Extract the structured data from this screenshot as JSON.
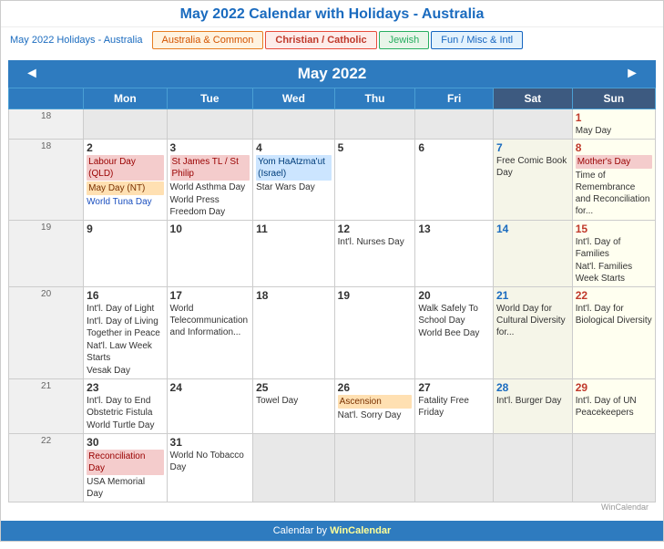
{
  "header": {
    "title": "May 2022 Calendar with Holidays - Australia"
  },
  "filter": {
    "label": "May 2022 Holidays - Australia",
    "tabs": [
      {
        "label": "Australia & Common",
        "class": "australia"
      },
      {
        "label": "Christian / Catholic",
        "class": "christian"
      },
      {
        "label": "Jewish",
        "class": "jewish"
      },
      {
        "label": "Fun / Misc & Intl",
        "class": "fun"
      }
    ]
  },
  "calendar": {
    "nav_prev": "◄",
    "nav_next": "►",
    "month_year": "May 2022",
    "days_of_week": [
      "Mon",
      "Tue",
      "Wed",
      "Thu",
      "Fri",
      "Sat",
      "Sun"
    ],
    "weeks": [
      {
        "week_num": "18",
        "days": [
          {
            "date": "",
            "events": [],
            "empty": true
          },
          {
            "date": "",
            "events": [],
            "empty": true
          },
          {
            "date": "",
            "events": [],
            "empty": true
          },
          {
            "date": "",
            "events": [],
            "empty": true
          },
          {
            "date": "",
            "events": [],
            "empty": true
          },
          {
            "date": "",
            "events": [],
            "empty": true
          },
          {
            "date": "1",
            "events": [
              {
                "text": "May Day",
                "class": ""
              }
            ],
            "empty": false,
            "type": "sun"
          }
        ]
      },
      {
        "week_num": "18",
        "days": [
          {
            "date": "2",
            "events": [
              {
                "text": "Labour Day (QLD)",
                "class": "red-bg"
              },
              {
                "text": "May Day (NT)",
                "class": "orange-bg"
              },
              {
                "text": "World Tuna Day",
                "class": "blue-text"
              }
            ],
            "empty": false,
            "type": "mon"
          },
          {
            "date": "3",
            "events": [
              {
                "text": "St James TL / St Philip",
                "class": "red-bg"
              },
              {
                "text": "World Asthma Day",
                "class": ""
              },
              {
                "text": "World Press Freedom Day",
                "class": ""
              }
            ],
            "empty": false,
            "type": "tue"
          },
          {
            "date": "4",
            "events": [
              {
                "text": "Yom HaAtzma'ut (Israel)",
                "class": "blue-bg"
              },
              {
                "text": "Star Wars Day",
                "class": ""
              }
            ],
            "empty": false,
            "type": "wed"
          },
          {
            "date": "5",
            "events": [],
            "empty": false,
            "type": "thu"
          },
          {
            "date": "6",
            "events": [],
            "empty": false,
            "type": "fri"
          },
          {
            "date": "7",
            "events": [
              {
                "text": "Free Comic Book Day",
                "class": ""
              }
            ],
            "empty": false,
            "type": "sat"
          },
          {
            "date": "8",
            "events": [
              {
                "text": "Mother's Day",
                "class": "red-bg"
              },
              {
                "text": "Time of Remembrance and Reconciliation for...",
                "class": ""
              }
            ],
            "empty": false,
            "type": "sun"
          }
        ]
      },
      {
        "week_num": "19",
        "days": [
          {
            "date": "9",
            "events": [],
            "empty": false,
            "type": "mon"
          },
          {
            "date": "10",
            "events": [],
            "empty": false,
            "type": "tue"
          },
          {
            "date": "11",
            "events": [],
            "empty": false,
            "type": "wed"
          },
          {
            "date": "12",
            "events": [
              {
                "text": "Int'l. Nurses Day",
                "class": ""
              }
            ],
            "empty": false,
            "type": "thu"
          },
          {
            "date": "13",
            "events": [],
            "empty": false,
            "type": "fri"
          },
          {
            "date": "14",
            "events": [],
            "empty": false,
            "type": "sat"
          },
          {
            "date": "15",
            "events": [
              {
                "text": "Int'l. Day of Families",
                "class": ""
              },
              {
                "text": "Nat'l. Families Week Starts",
                "class": ""
              }
            ],
            "empty": false,
            "type": "sun"
          }
        ]
      },
      {
        "week_num": "20",
        "days": [
          {
            "date": "16",
            "events": [
              {
                "text": "Int'l. Day of Light",
                "class": ""
              },
              {
                "text": "Int'l. Day of Living Together in Peace",
                "class": ""
              },
              {
                "text": "Nat'l. Law Week Starts",
                "class": ""
              },
              {
                "text": "Vesak Day",
                "class": ""
              }
            ],
            "empty": false,
            "type": "mon"
          },
          {
            "date": "17",
            "events": [
              {
                "text": "World Telecommunication and Information...",
                "class": ""
              }
            ],
            "empty": false,
            "type": "tue"
          },
          {
            "date": "18",
            "events": [],
            "empty": false,
            "type": "wed"
          },
          {
            "date": "19",
            "events": [],
            "empty": false,
            "type": "thu"
          },
          {
            "date": "20",
            "events": [
              {
                "text": "Walk Safely To School Day",
                "class": ""
              },
              {
                "text": "World Bee Day",
                "class": ""
              }
            ],
            "empty": false,
            "type": "fri"
          },
          {
            "date": "21",
            "events": [
              {
                "text": "World Day for Cultural Diversity for...",
                "class": ""
              }
            ],
            "empty": false,
            "type": "sat"
          },
          {
            "date": "22",
            "events": [
              {
                "text": "Int'l. Day for Biological Diversity",
                "class": ""
              }
            ],
            "empty": false,
            "type": "sun"
          }
        ]
      },
      {
        "week_num": "21",
        "days": [
          {
            "date": "23",
            "events": [
              {
                "text": "Int'l. Day to End Obstetric Fistula",
                "class": ""
              },
              {
                "text": "World Turtle Day",
                "class": ""
              }
            ],
            "empty": false,
            "type": "mon"
          },
          {
            "date": "24",
            "events": [],
            "empty": false,
            "type": "tue"
          },
          {
            "date": "25",
            "events": [
              {
                "text": "Towel Day",
                "class": ""
              }
            ],
            "empty": false,
            "type": "wed"
          },
          {
            "date": "26",
            "events": [
              {
                "text": "Ascension",
                "class": "orange-bg"
              },
              {
                "text": "Nat'l. Sorry Day",
                "class": ""
              }
            ],
            "empty": false,
            "type": "thu"
          },
          {
            "date": "27",
            "events": [
              {
                "text": "Fatality Free Friday",
                "class": ""
              }
            ],
            "empty": false,
            "type": "fri"
          },
          {
            "date": "28",
            "events": [
              {
                "text": "Int'l. Burger Day",
                "class": ""
              }
            ],
            "empty": false,
            "type": "sat"
          },
          {
            "date": "29",
            "events": [
              {
                "text": "Int'l. Day of UN Peacekeepers",
                "class": ""
              }
            ],
            "empty": false,
            "type": "sun"
          }
        ]
      },
      {
        "week_num": "22",
        "days": [
          {
            "date": "30",
            "events": [
              {
                "text": "Reconciliation Day",
                "class": "red-bg"
              },
              {
                "text": "USA Memorial Day",
                "class": ""
              }
            ],
            "empty": false,
            "type": "mon"
          },
          {
            "date": "31",
            "events": [
              {
                "text": "World No Tobacco Day",
                "class": ""
              }
            ],
            "empty": false,
            "type": "tue"
          },
          {
            "date": "",
            "events": [],
            "empty": true
          },
          {
            "date": "",
            "events": [],
            "empty": true
          },
          {
            "date": "",
            "events": [],
            "empty": true
          },
          {
            "date": "",
            "events": [],
            "empty": true
          },
          {
            "date": "",
            "events": [],
            "empty": true
          }
        ]
      }
    ]
  },
  "footer": {
    "text": "Calendar by ",
    "link_text": "WinCalendar",
    "credit": "WinCalendar"
  }
}
